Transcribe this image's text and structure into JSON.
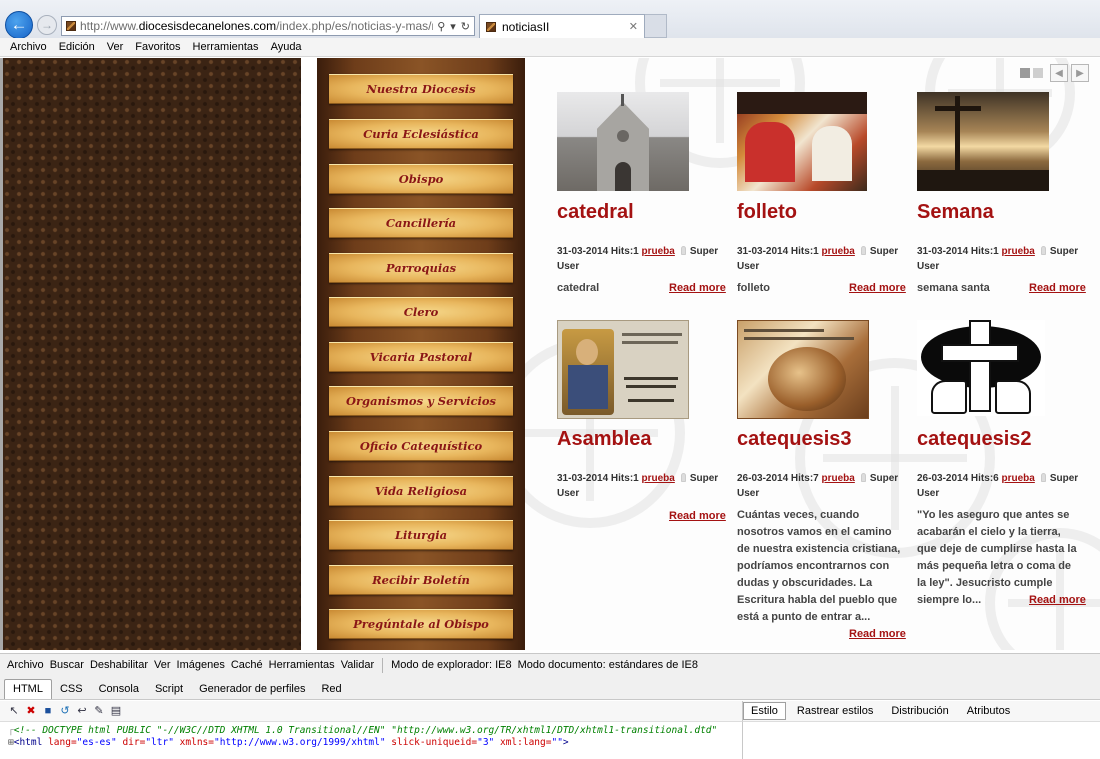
{
  "browser": {
    "url_prefix": "http://www.",
    "url_domain": "diocesisdecanelones.com",
    "url_path": "/index.php/es/noticias-y-mas/noticiasii.ht",
    "tab_title": "noticiasII",
    "menu": [
      "Archivo",
      "Edición",
      "Ver",
      "Favoritos",
      "Herramientas",
      "Ayuda"
    ]
  },
  "site": {
    "nav_menu": [
      "Nuestra Diocesis",
      "Curia Eclesiástica",
      "Obispo",
      "Cancillería",
      "Parroquias",
      "Clero",
      "Vicaria Pastoral",
      "Organismos y Servicios",
      "Oficio Catequístico",
      "Vida Religiosa",
      "Liturgia",
      "Recibir Boletín",
      "Pregúntale al Obispo"
    ],
    "articles": [
      {
        "title": "catedral",
        "date_hits": "31-03-2014 Hits:1",
        "category": "prueba",
        "author_a": "Super",
        "author_b": "User",
        "intro": "catedral",
        "read_more": "Read more"
      },
      {
        "title": "folleto",
        "date_hits": "31-03-2014 Hits:1",
        "category": "prueba",
        "author_a": "Super",
        "author_b": "User",
        "intro": "folleto",
        "read_more": "Read more"
      },
      {
        "title": "Semana",
        "date_hits": "31-03-2014 Hits:1",
        "category": "prueba",
        "author_a": "Super",
        "author_b": "User",
        "intro": "semana santa",
        "read_more": "Read more"
      },
      {
        "title": "Asamblea",
        "date_hits": "31-03-2014 Hits:1",
        "category": "prueba",
        "author_a": "Super",
        "author_b": "User",
        "intro": "",
        "read_more": "Read more"
      },
      {
        "title": "catequesis3",
        "date_hits": "26-03-2014 Hits:7",
        "category": "prueba",
        "author_a": "Super",
        "author_b": "User",
        "intro": "Cuántas veces, cuando nosotros vamos en el camino de nuestra existencia cristiana, podríamos encontrarnos con dudas y obscuridades. La Escritura habla del pueblo que está a punto de entrar a...",
        "read_more": "Read more"
      },
      {
        "title": "catequesis2",
        "date_hits": "26-03-2014 Hits:6",
        "category": "prueba",
        "author_a": "Super",
        "author_b": "User",
        "intro": "\"Yo les aseguro que antes se acabarán el cielo y la tierra, que deje de cumplirse hasta la más pequeña letra o coma de la ley\". Jesucristo cumple siempre lo...",
        "read_more": "Read more"
      }
    ],
    "slider_prev": "◀",
    "slider_next": "▶"
  },
  "devtools": {
    "menu": [
      "Archivo",
      "Buscar",
      "Deshabilitar",
      "Ver",
      "Imágenes",
      "Caché",
      "Herramientas",
      "Validar"
    ],
    "browser_mode": "Modo de explorador: IE8",
    "doc_mode": "Modo documento: estándares de IE8",
    "tabs": [
      "HTML",
      "CSS",
      "Consola",
      "Script",
      "Generador de perfiles",
      "Red"
    ],
    "right_tabs": [
      "Estilo",
      "Rastrear estilos",
      "Distribución",
      "Atributos"
    ],
    "source_line1": "<!-- DOCTYPE html PUBLIC \"-//W3C//DTD XHTML 1.0 Transitional//EN\" \"http://www.w3.org/TR/xhtml1/DTD/xhtml1-transitional.dtd\"",
    "src2_open": "<html ",
    "src2_a1": "lang=",
    "src2_v1": "\"es-es\"",
    "src2_a2": " dir=",
    "src2_v2": "\"ltr\"",
    "src2_a3": " xmlns=",
    "src2_v3": "\"http://www.w3.org/1999/xhtml\"",
    "src2_a4": " slick-uniqueid=",
    "src2_v4": "\"3\"",
    "src2_a5": " xml:lang=",
    "src2_v5": "\"\"",
    "src2_close": ">"
  },
  "colors": {
    "accent_red": "#a41212",
    "menu_text": "#8a1616",
    "wood_dark": "#3b2414"
  }
}
